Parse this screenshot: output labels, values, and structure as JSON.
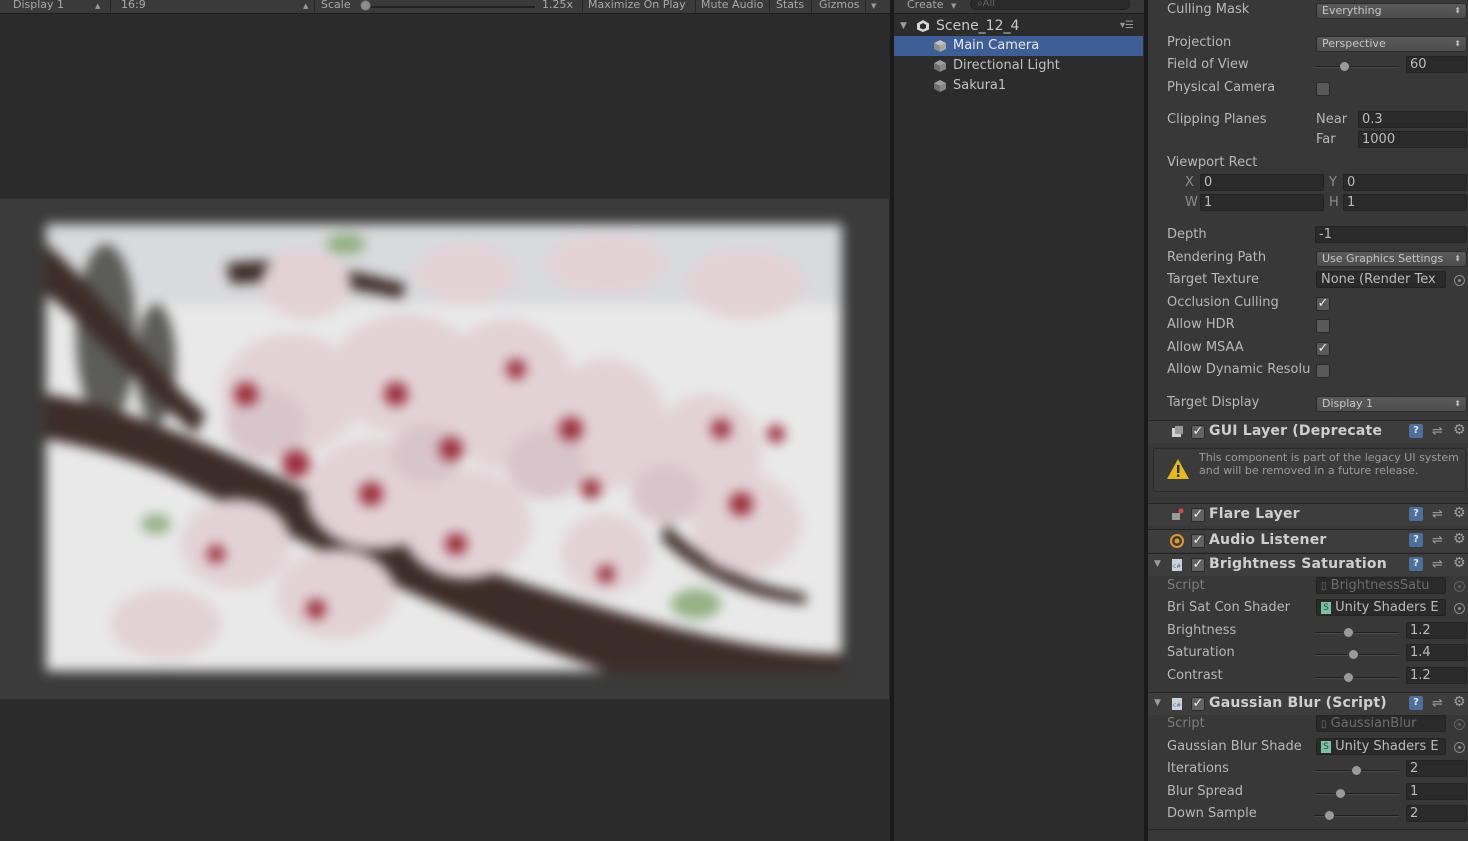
{
  "game_toolbar": {
    "display": "Display 1",
    "aspect": "16:9",
    "scale_label": "Scale",
    "scale_value": "1.25x",
    "maximize_on_play": "Maximize On Play",
    "mute_audio": "Mute Audio",
    "stats": "Stats",
    "gizmos": "Gizmos"
  },
  "hierarchy": {
    "create_label": "Create",
    "search_placeholder": "All",
    "scene_name": "Scene_12_4",
    "items": [
      {
        "label": "Main Camera",
        "selected": true
      },
      {
        "label": "Directional Light",
        "selected": false
      },
      {
        "label": "Sakura1",
        "selected": false
      }
    ]
  },
  "camera": {
    "culling_mask_label": "Culling Mask",
    "culling_mask_value": "Everything",
    "projection_label": "Projection",
    "projection_value": "Perspective",
    "fov_label": "Field of View",
    "fov_value": "60",
    "physical_camera_label": "Physical Camera",
    "clipping_planes_label": "Clipping Planes",
    "near_label": "Near",
    "near_value": "0.3",
    "far_label": "Far",
    "far_value": "1000",
    "viewport_rect_label": "Viewport Rect",
    "x_label": "X",
    "x_value": "0",
    "y_label": "Y",
    "y_value": "0",
    "w_label": "W",
    "w_value": "1",
    "h_label": "H",
    "h_value": "1",
    "depth_label": "Depth",
    "depth_value": "-1",
    "rendering_path_label": "Rendering Path",
    "rendering_path_value": "Use Graphics Settings",
    "target_texture_label": "Target Texture",
    "target_texture_value": "None (Render Tex",
    "occlusion_culling_label": "Occlusion Culling",
    "allow_hdr_label": "Allow HDR",
    "allow_msaa_label": "Allow MSAA",
    "allow_dynamic_label": "Allow Dynamic Resolu",
    "target_display_label": "Target Display",
    "target_display_value": "Display 1"
  },
  "gui_layer": {
    "title": "GUI Layer (Deprecate",
    "warning": "This component is part of the legacy UI system and will be removed in a future release."
  },
  "flare_layer": {
    "title": "Flare Layer"
  },
  "audio_listener": {
    "title": "Audio Listener"
  },
  "brightness_saturation": {
    "title": "Brightness Saturation",
    "script_label": "Script",
    "script_value": "BrightnessSatu",
    "shader_label": "Bri Sat Con Shader",
    "shader_value": "Unity Shaders E",
    "brightness_label": "Brightness",
    "brightness_value": "1.2",
    "saturation_label": "Saturation",
    "saturation_value": "1.4",
    "contrast_label": "Contrast",
    "contrast_value": "1.2"
  },
  "gaussian_blur": {
    "title": "Gaussian Blur (Script)",
    "script_label": "Script",
    "script_value": "GaussianBlur",
    "shader_label": "Gaussian Blur Shade",
    "shader_value": "Unity Shaders E",
    "iterations_label": "Iterations",
    "iterations_value": "2",
    "blur_spread_label": "Blur Spread",
    "blur_spread_value": "1",
    "down_sample_label": "Down Sample",
    "down_sample_value": "2"
  }
}
